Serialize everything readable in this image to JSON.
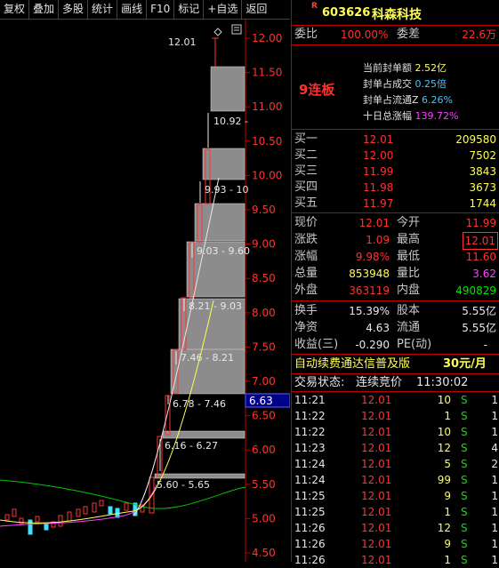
{
  "toolbar": {
    "buttons": [
      "复权",
      "叠加",
      "多股",
      "统计",
      "画线",
      "F10",
      "标记",
      "+自选",
      "返回"
    ]
  },
  "chart": {
    "price_axis_labels": [
      "12.00",
      "11.50",
      "11.00",
      "10.50",
      "10.00",
      "9.50",
      "9.00",
      "8.50",
      "8.00",
      "7.50",
      "7.00",
      "6.50",
      "6.00",
      "5.50",
      "5.00",
      "4.50"
    ],
    "current_price_tag": "6.63",
    "annotations": {
      "top_price": "12.01",
      "a1": "10.92 -",
      "a2": "9.93 - 10",
      "a3": "9.03 - 9.60",
      "a4": "8.21 - 9.03",
      "a5": "7.46 - 8.21",
      "a6": "6.78 - 7.46",
      "a7": "6.16 - 6.27",
      "a8": "5.60 - 5.65"
    }
  },
  "stock": {
    "r_mark": "R",
    "code": "603626",
    "name": "科森科技"
  },
  "weibi": {
    "label": "委比",
    "value": "100.00%",
    "label2": "委差",
    "value2": "22.6万"
  },
  "limit_info": {
    "streak": "9连板",
    "lines": [
      {
        "label": "当前封单额",
        "value": "2.52亿"
      },
      {
        "label": "封单占成交",
        "value": "0.25倍"
      },
      {
        "label": "封单占流通Z",
        "value": "6.26%"
      },
      {
        "label": "十日总涨幅",
        "value": "139.72%"
      }
    ]
  },
  "order_book": [
    {
      "label": "买一",
      "price": "12.01",
      "vol": "209580"
    },
    {
      "label": "买二",
      "price": "12.00",
      "vol": "7502"
    },
    {
      "label": "买三",
      "price": "11.99",
      "vol": "3843"
    },
    {
      "label": "买四",
      "price": "11.98",
      "vol": "3673"
    },
    {
      "label": "买五",
      "price": "11.97",
      "vol": "1744"
    }
  ],
  "quote": {
    "xianjia": {
      "label": "现价",
      "value": "12.01",
      "label2": "今开",
      "value2": "11.99"
    },
    "zhangdie": {
      "label": "涨跌",
      "value": "1.09",
      "label2": "最高",
      "value2": "12.01"
    },
    "zhangfu": {
      "label": "涨幅",
      "value": "9.98%",
      "label2": "最低",
      "value2": "11.60"
    },
    "zongliang": {
      "label": "总量",
      "value": "853948",
      "label2": "量比",
      "value2": "3.62"
    },
    "waipan": {
      "label": "外盘",
      "value": "363119",
      "label2": "内盘",
      "value2": "490829"
    }
  },
  "fundamentals": {
    "huanshou": {
      "label": "换手",
      "value": "15.39%",
      "label2": "股本",
      "value2": "5.55亿"
    },
    "jingzi": {
      "label": "净资",
      "value": "4.63",
      "label2": "流通",
      "value2": "5.55亿"
    },
    "shouyi": {
      "label": "收益(三)",
      "value": "-0.290",
      "label2": "PE(动)",
      "value2": "-"
    }
  },
  "promo": {
    "text": "自动续费通达信普及版",
    "price": "30元/月"
  },
  "trade_status": {
    "label": "交易状态:",
    "value": "连续竞价",
    "time": "11:30:02"
  },
  "ticks": [
    {
      "time": "11:21",
      "price": "12.01",
      "vol": "10",
      "side": "S",
      "n": "1"
    },
    {
      "time": "11:22",
      "price": "12.01",
      "vol": "1",
      "side": "S",
      "n": "1"
    },
    {
      "time": "11:22",
      "price": "12.01",
      "vol": "10",
      "side": "S",
      "n": "1"
    },
    {
      "time": "11:23",
      "price": "12.01",
      "vol": "12",
      "side": "S",
      "n": "4"
    },
    {
      "time": "11:24",
      "price": "12.01",
      "vol": "5",
      "side": "S",
      "n": "2"
    },
    {
      "time": "11:24",
      "price": "12.01",
      "vol": "99",
      "side": "S",
      "n": "1"
    },
    {
      "time": "11:25",
      "price": "12.01",
      "vol": "9",
      "side": "S",
      "n": "1"
    },
    {
      "time": "11:25",
      "price": "12.01",
      "vol": "1",
      "side": "S",
      "n": "1"
    },
    {
      "time": "11:26",
      "price": "12.01",
      "vol": "12",
      "side": "S",
      "n": "1"
    },
    {
      "time": "11:26",
      "price": "12.01",
      "vol": "9",
      "side": "S",
      "n": "1"
    },
    {
      "time": "11:26",
      "price": "12.01",
      "vol": "1",
      "side": "S",
      "n": "1"
    }
  ]
}
